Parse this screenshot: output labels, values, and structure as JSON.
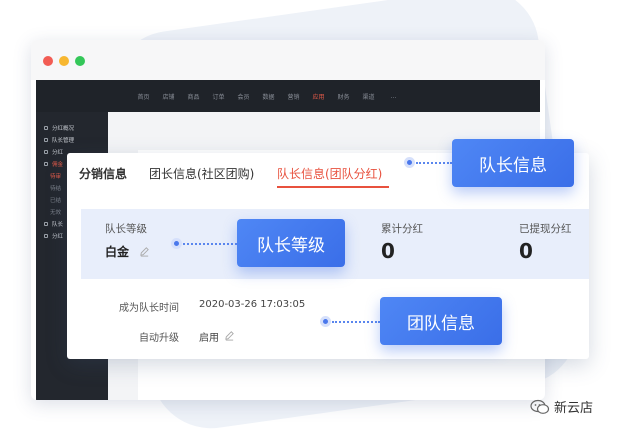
{
  "topnav": {
    "items": [
      "首页",
      "店铺",
      "商品",
      "订单",
      "会员",
      "数据",
      "营销",
      "应用",
      "财务",
      "渠道",
      "…"
    ],
    "active_index": 7
  },
  "sidebar": {
    "items": [
      {
        "label": "分红概况",
        "type": "main"
      },
      {
        "label": "队长管理",
        "type": "main"
      },
      {
        "label": "分红",
        "type": "main"
      },
      {
        "label": "佣金",
        "type": "main"
      },
      {
        "label": "待审",
        "type": "sub"
      },
      {
        "label": "待结",
        "type": "sub"
      },
      {
        "label": "已结",
        "type": "sub"
      },
      {
        "label": "无效",
        "type": "sub"
      },
      {
        "label": "队长",
        "type": "main"
      },
      {
        "label": "分红",
        "type": "main"
      }
    ]
  },
  "card": {
    "tabs": [
      "分销信息",
      "团长信息(社区团购)",
      "队长信息(团队分红)"
    ],
    "active_tab": 2,
    "level_label": "队长等级",
    "level_value": "白金",
    "total_label": "累计分红",
    "total_value": "0",
    "withdrawn_label": "已提现分红",
    "withdrawn_value": "0",
    "become_label": "成为队长时间",
    "become_value": "2020-03-26 17:03:05",
    "auto_label": "自动升级",
    "auto_value": "启用"
  },
  "callouts": {
    "captain_info": "队长信息",
    "captain_level": "队长等级",
    "team_info": "团队信息"
  },
  "watermark": {
    "text": "新云店"
  },
  "colors": {
    "accent_red": "#e8513e",
    "callout_blue": "#3a6ee8",
    "sidebar_dark": "#23272e"
  }
}
